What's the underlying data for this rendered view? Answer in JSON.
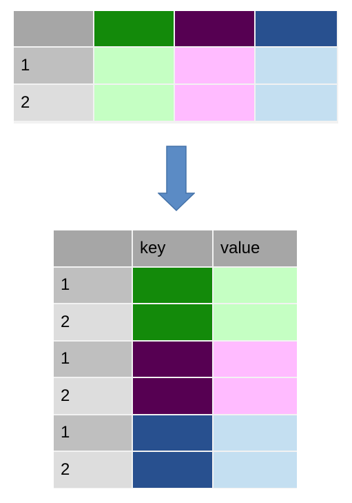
{
  "colors": {
    "header_grey": "#a6a6a6",
    "id_dark": "#bfbfbf",
    "id_light": "#dddddd",
    "grid_line": "#f2f2f2",
    "arrow_fill": "#5b8bc5",
    "arrow_stroke": "#4472a8",
    "series": [
      {
        "key": "#138a0a",
        "value": "#c5ffc3"
      },
      {
        "key": "#560052",
        "value": "#ffbbff"
      },
      {
        "key": "#28508f",
        "value": "#c4dff1"
      }
    ]
  },
  "wide_table": {
    "ids": [
      "1",
      "2"
    ]
  },
  "long_table": {
    "headers": {
      "key": "key",
      "value": "value"
    },
    "rows": [
      {
        "id": "1",
        "series": 0
      },
      {
        "id": "2",
        "series": 0
      },
      {
        "id": "1",
        "series": 1
      },
      {
        "id": "2",
        "series": 1
      },
      {
        "id": "1",
        "series": 2
      },
      {
        "id": "2",
        "series": 2
      }
    ]
  },
  "arrow_icon": "down-arrow-icon"
}
